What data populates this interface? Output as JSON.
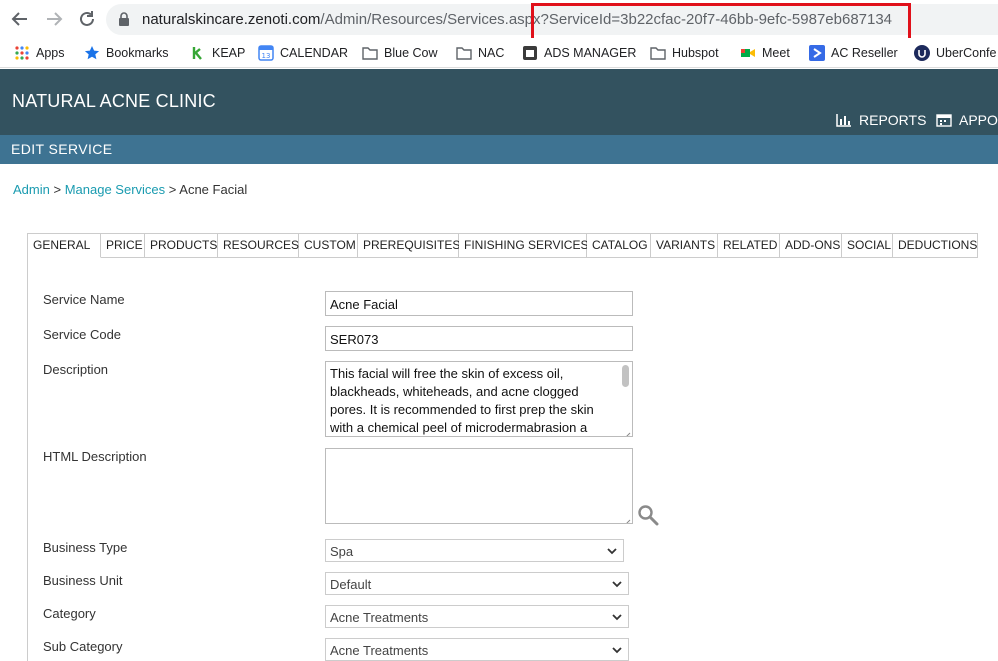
{
  "browser": {
    "url_host": "naturalskincare.zenoti.com",
    "url_path": "/Admin/Resources/Services.aspx",
    "url_query": "?ServiceId=3b22cfac-20f7-46bb-9efc-5987eb687134"
  },
  "bookmarks": [
    {
      "label": "Apps",
      "icon": "apps-grid-icon"
    },
    {
      "label": "Bookmarks",
      "icon": "star-icon"
    },
    {
      "label": "KEAP",
      "icon": "keap-icon"
    },
    {
      "label": "CALENDAR",
      "icon": "calendar-icon"
    },
    {
      "label": "Blue Cow",
      "icon": "folder-icon"
    },
    {
      "label": "NAC",
      "icon": "folder-icon"
    },
    {
      "label": "ADS MANAGER",
      "icon": "ads-icon"
    },
    {
      "label": "Hubspot",
      "icon": "folder-icon"
    },
    {
      "label": "Meet",
      "icon": "meet-icon"
    },
    {
      "label": "AC Reseller",
      "icon": "ac-icon"
    },
    {
      "label": "UberConfe",
      "icon": "uberconference-icon"
    }
  ],
  "header": {
    "clinic_name": "NATURAL ACNE CLINIC",
    "reports_label": "REPORTS",
    "appointments_label": "APPOI"
  },
  "edit_bar": {
    "title": "EDIT SERVICE"
  },
  "breadcrumb": {
    "admin": "Admin",
    "manage_services": "Manage Services",
    "current": "Acne Facial",
    "separator": ">"
  },
  "tabs": [
    "GENERAL",
    "PRICE",
    "PRODUCTS",
    "RESOURCES",
    "CUSTOM",
    "PREREQUISITES",
    "FINISHING SERVICES",
    "CATALOG",
    "VARIANTS",
    "RELATED",
    "ADD-ONS",
    "SOCIAL",
    "DEDUCTIONS"
  ],
  "active_tab": "GENERAL",
  "form": {
    "service_name_label": "Service Name",
    "service_name_value": "Acne Facial",
    "service_code_label": "Service Code",
    "service_code_value": "SER073",
    "description_label": "Description",
    "description_value": "This facial will free the skin of excess oil, blackheads, whiteheads, and acne clogged pores. It is recommended to first prep the skin with a chemical peel of microdermabrasion a",
    "html_description_label": "HTML Description",
    "html_description_value": "",
    "business_type_label": "Business Type",
    "business_type_value": "Spa",
    "business_unit_label": "Business Unit",
    "business_unit_value": "Default",
    "category_label": "Category",
    "category_value": "Acne Treatments",
    "sub_category_label": "Sub Category",
    "sub_category_value": "Acne Treatments"
  },
  "colors": {
    "header_bg": "#33525f",
    "edit_bar_bg": "#3e7392",
    "link": "#1a9bb0",
    "highlight": "#e0101a"
  }
}
